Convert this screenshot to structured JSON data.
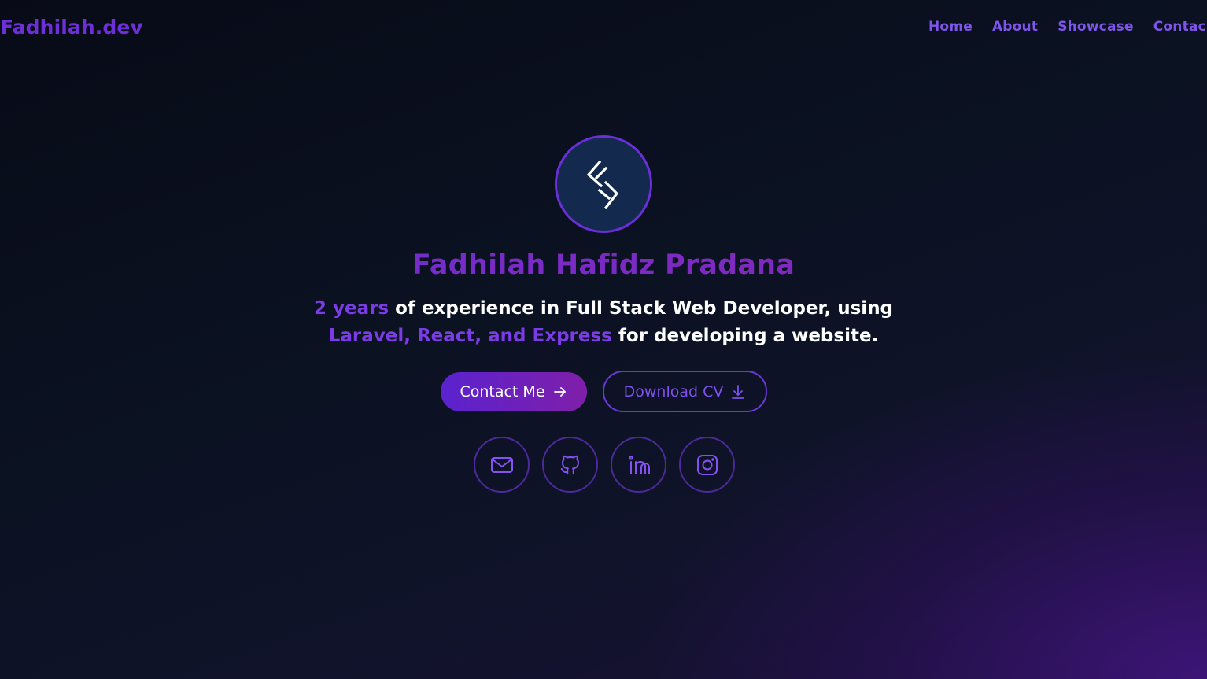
{
  "header": {
    "brand": "Fadhilah.dev",
    "nav": [
      {
        "label": "Home"
      },
      {
        "label": "About"
      },
      {
        "label": "Showcase"
      },
      {
        "label": "Contac"
      }
    ]
  },
  "hero": {
    "avatar_icon": "sf-monogram-logo",
    "name": "Fadhilah Hafidz Pradana",
    "tagline": {
      "accent_1": "2 years",
      "text_1": " of experience in Full Stack Web Developer, using ",
      "accent_2": "Laravel, React, and Express",
      "text_2": " for developing a website."
    },
    "buttons": {
      "contact": {
        "label": "Contact Me",
        "icon": "arrow-right-icon"
      },
      "download": {
        "label": "Download CV",
        "icon": "download-icon"
      }
    },
    "socials": [
      {
        "icon": "mail-icon"
      },
      {
        "icon": "github-icon"
      },
      {
        "icon": "linkedin-icon"
      },
      {
        "icon": "instagram-icon"
      }
    ]
  },
  "colors": {
    "accent": "#6d2fd6",
    "accent_light": "#7e55ea",
    "background": "#0b1222",
    "avatar_bg": "#13294d"
  }
}
